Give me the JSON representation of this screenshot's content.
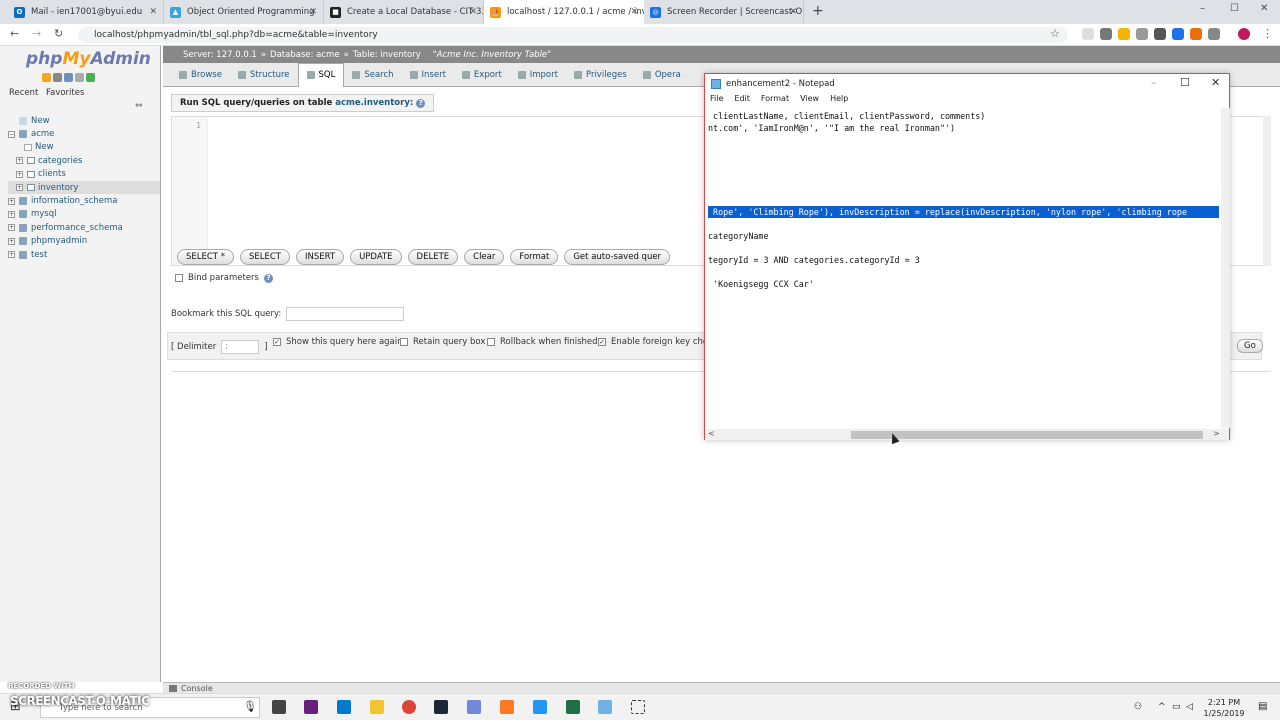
{
  "browser": {
    "tabs": [
      {
        "label": "Mail - ien17001@byui.edu",
        "fav": "#0f6cbd",
        "glyph": "O"
      },
      {
        "label": "Object Oriented Programming",
        "fav": "#3aa5d8",
        "glyph": "▲"
      },
      {
        "label": "Create a Local Database - CIT 33",
        "fav": "#222",
        "glyph": "■"
      },
      {
        "label": "localhost / 127.0.0.1 / acme / inv",
        "fav": "#f89c0e",
        "glyph": "⛵"
      },
      {
        "label": "Screen Recorder | Screencast-O",
        "fav": "#1a73e8",
        "glyph": "◎"
      }
    ],
    "new_tab": "+",
    "url": "localhost/phpmyadmin/tbl_sql.php?db=acme&table=inventory",
    "controls": {
      "min": "–",
      "max": "☐",
      "close": "✕"
    }
  },
  "pma": {
    "logo": {
      "php": "php",
      "my": "My",
      "admin": "Admin"
    },
    "recent": "Recent",
    "favorites": "Favorites",
    "tree": [
      {
        "label": "New",
        "level": 0,
        "type": "new"
      },
      {
        "label": "acme",
        "level": 0,
        "type": "db"
      },
      {
        "label": "New",
        "level": 1,
        "type": "new"
      },
      {
        "label": "categories",
        "level": 1,
        "type": "tbl"
      },
      {
        "label": "clients",
        "level": 1,
        "type": "tbl"
      },
      {
        "label": "inventory",
        "level": 1,
        "type": "tbl",
        "selected": true
      },
      {
        "label": "information_schema",
        "level": 0,
        "type": "db"
      },
      {
        "label": "mysql",
        "level": 0,
        "type": "db"
      },
      {
        "label": "performance_schema",
        "level": 0,
        "type": "db"
      },
      {
        "label": "phpmyadmin",
        "level": 0,
        "type": "db"
      },
      {
        "label": "test",
        "level": 0,
        "type": "db"
      }
    ],
    "breadcrumb": {
      "server": "Server: 127.0.0.1",
      "database": "Database: acme",
      "table": "Table: inventory",
      "comment": "\"Acme Inc. Inventory Table\""
    },
    "menu": [
      "Browse",
      "Structure",
      "SQL",
      "Search",
      "Insert",
      "Export",
      "Import",
      "Privileges",
      "Opera"
    ],
    "sql_heading_prefix": "Run SQL query/queries on table",
    "sql_heading_table": "acme.inventory:",
    "editor_line": "1",
    "buttons": [
      "SELECT *",
      "SELECT",
      "INSERT",
      "UPDATE",
      "DELETE",
      "Clear",
      "Format",
      "Get auto-saved quer"
    ],
    "bind_parameters": "Bind parameters",
    "bookmark_label": "Bookmark this SQL query:",
    "delimiter_label": "[ Delimiter",
    "delimiter_value": ";",
    "delimiter_close": "]",
    "options": [
      {
        "label": "Show this query here again",
        "checked": true
      },
      {
        "label": "Retain query box",
        "checked": false
      },
      {
        "label": "Rollback when finished",
        "checked": false
      },
      {
        "label": "Enable foreign key chec",
        "checked": true
      }
    ],
    "go": "Go",
    "console": "Console"
  },
  "notepad": {
    "title": "enhancement2 - Notepad",
    "menu": [
      "File",
      "Edit",
      "Format",
      "View",
      "Help"
    ],
    "lines": [
      {
        "text": " clientLastName, clientEmail, clientPassword, comments)",
        "row": 0,
        "hl": false
      },
      {
        "text": "nt.com', 'IamIronM@n', '\"I am the real Ironman\"')",
        "row": 1,
        "hl": false
      },
      {
        "text": " Rope', 'Climbing Rope'), invDescription = replace(invDescription, 'nylon rope', 'climbing rope",
        "row": 8,
        "hl": true
      },
      {
        "text": "categoryName",
        "row": 10,
        "hl": false
      },
      {
        "text": "tegoryId = 3 AND categories.categoryId = 3",
        "row": 12,
        "hl": false
      },
      {
        "text": " 'Koenigsegg CCX Car'",
        "row": 14,
        "hl": false
      }
    ],
    "scroll_left": "<",
    "scroll_right": ">"
  },
  "taskbar": {
    "search_placeholder": "Type here to search",
    "time": "2:21 PM",
    "date": "1/25/2019"
  },
  "watermark": {
    "top": "RECORDED WITH",
    "brand": "SCREENCAST-O-MATIC"
  }
}
